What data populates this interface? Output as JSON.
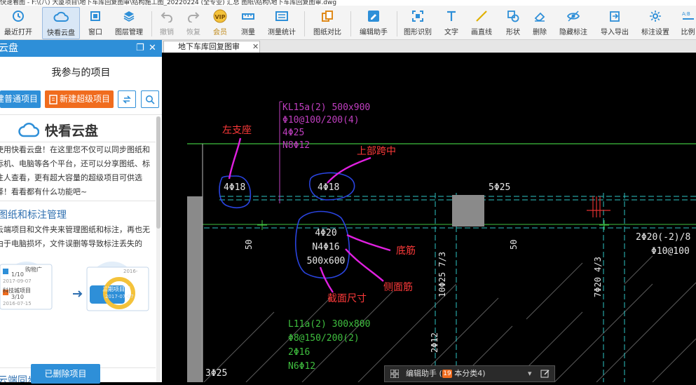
{
  "window": {
    "title": "快速看图 - F:\\(八) 大厦项目\\地下车库回复图审\\结构施工图_20220224 (全专业) 汇总 图纸\\结构\\地下车库回复图审.dwg"
  },
  "toolbar": {
    "items": [
      {
        "label": "最近打开",
        "icon": "history-icon"
      },
      {
        "label": "快看云盘",
        "icon": "cloud-icon",
        "active": true
      },
      {
        "label": "窗口",
        "icon": "window-icon"
      },
      {
        "label": "图层管理",
        "icon": "layers-icon"
      },
      {
        "label": "撤销",
        "icon": "undo-icon",
        "disabled": true
      },
      {
        "label": "恢复",
        "icon": "redo-icon",
        "disabled": true
      },
      {
        "label": "会员",
        "icon": "vip-icon"
      },
      {
        "label": "测量",
        "icon": "measure-icon"
      },
      {
        "label": "测量统计",
        "icon": "measure-stats-icon"
      },
      {
        "label": "图纸对比",
        "icon": "compare-icon"
      },
      {
        "label": "编辑助手",
        "icon": "edit-assistant-icon"
      },
      {
        "label": "图形识别",
        "icon": "shape-recognize-icon"
      },
      {
        "label": "文字",
        "icon": "text-icon"
      },
      {
        "label": "画直线",
        "icon": "line-icon"
      },
      {
        "label": "形状",
        "icon": "shape-icon"
      },
      {
        "label": "删除",
        "icon": "eraser-icon"
      },
      {
        "label": "隐藏标注",
        "icon": "hide-annotation-icon"
      },
      {
        "label": "导入导出",
        "icon": "import-export-icon"
      },
      {
        "label": "标注设置",
        "icon": "annotation-settings-icon"
      },
      {
        "label": "比例",
        "icon": "scale-icon"
      }
    ]
  },
  "panel": {
    "title": "云盘",
    "projects_title": "我参与的项目",
    "new_normal_project": "建普通项目",
    "new_super_project": "新建超级项目",
    "brand": "快看云盘",
    "intro": "使用快看云盘！在这里您不仅可以同步图纸和标机、电脑等各个平台，还可以分享图纸、标注人查看，更有超大容量的超级项目可供选择！看看都有什么功能吧~",
    "section1_title": "图纸和标注管理",
    "section1_text": "云端项目和文件夹来管理图纸和标注，再也无由于电脑损坏，文件误删等导致标注丢失的",
    "illus": {
      "card1_title": "购物广",
      "card1_count": "1/10",
      "card1_date": "2017-09-07",
      "card1_item": "科技城项目",
      "card1_item_count": "3/10",
      "card1_item_date": "2016-07-15",
      "card2_top": "2016-",
      "card2_title": "三期项目图",
      "card2_date": "2017-07-07"
    },
    "section2_title": "云端同步",
    "deleted_projects": "已删除项目",
    "accent_color": "#2e8fd8",
    "orange_color": "#f06c1e"
  },
  "tab": {
    "label": "地下车库回复图审",
    "close": "✕"
  },
  "drawing": {
    "beam1": [
      "KL15a(2) 500x900",
      "Φ10@100/200(4)",
      "4Φ25",
      "N8Φ12"
    ],
    "top_left_rebar": "4Φ18",
    "top_mid_rebar": "4Φ18",
    "top_right_rebar": "5Φ25",
    "section_rebar": [
      "4Φ20",
      "N4Φ16",
      "500x600"
    ],
    "right_rebar": [
      "2Φ20(-2)/8",
      "Φ10@100"
    ],
    "beam2": [
      "L11a(2) 300x800",
      "Φ8@150/200(2)",
      "2Φ16",
      "N6Φ12"
    ],
    "bottom_left_rebar": "3Φ25",
    "vertical_texts": [
      "50",
      "10Φ25 7/3",
      "50",
      "7Φ20 4/3",
      "2Φ12"
    ],
    "annotations": {
      "left_support": "左支座",
      "top_mid_span": "上部跨中",
      "bottom_rebar": "底筋",
      "side_rebar": "侧面筋",
      "section_size": "截面尺寸"
    }
  },
  "bottombar": {
    "text": "编辑助手 (19 本分类4)",
    "badge": "19"
  }
}
